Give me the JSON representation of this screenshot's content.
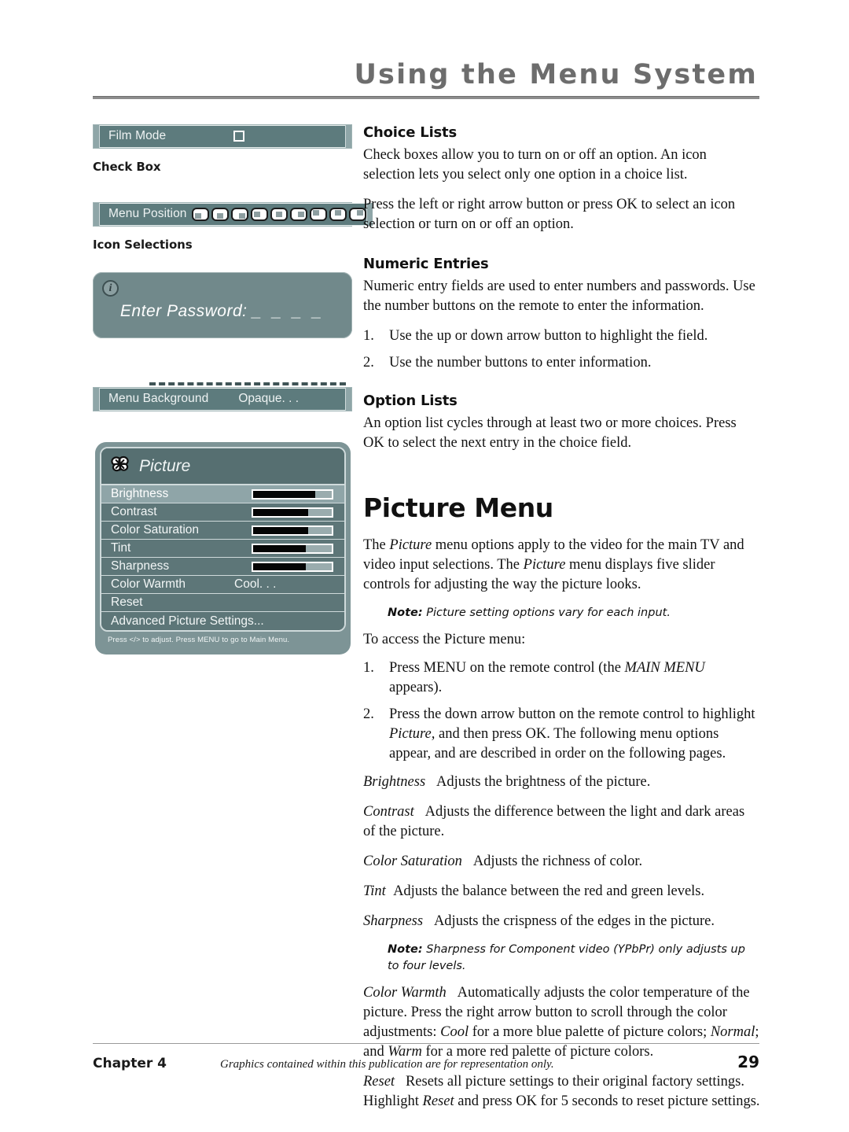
{
  "header": {
    "title": "Using the Menu System"
  },
  "osd": {
    "check_box": {
      "label": "Film Mode",
      "checkbox_state": "unchecked",
      "caption": "Check Box"
    },
    "icon_selections": {
      "label": "Menu Position",
      "caption": "Icon Selections",
      "icons": [
        "position-bottom-left",
        "position-bottom-center",
        "position-bottom-right",
        "position-middle-left",
        "position-middle-center",
        "position-middle-right",
        "position-top-left",
        "position-top-center",
        "position-top-right"
      ]
    },
    "password_box": {
      "info_glyph": "i",
      "prompt": "Enter Password:",
      "blanks": "_ _ _ _"
    },
    "menu_background": {
      "label": "Menu Background",
      "value": "Opaque. . ."
    }
  },
  "picture_menu_panel": {
    "icon": "butterfly-picture-icon",
    "title": "Picture",
    "rows": [
      {
        "label": "Brightness",
        "type": "slider",
        "fill_percent": 79,
        "highlighted": true
      },
      {
        "label": "Contrast",
        "type": "slider",
        "fill_percent": 70,
        "highlighted": false
      },
      {
        "label": "Color Saturation",
        "type": "slider",
        "fill_percent": 70,
        "highlighted": false
      },
      {
        "label": "Tint",
        "type": "slider",
        "fill_percent": 67,
        "highlighted": false
      },
      {
        "label": "Sharpness",
        "type": "slider",
        "fill_percent": 67,
        "highlighted": false
      },
      {
        "label": "Color Warmth",
        "type": "option",
        "value": "Cool. . .",
        "highlighted": false
      },
      {
        "label": "Reset",
        "type": "plain",
        "highlighted": false
      },
      {
        "label": "Advanced Picture Settings...",
        "type": "plain",
        "highlighted": false
      }
    ],
    "footer": "Press </> to adjust. Press MENU to go to Main Menu."
  },
  "content": {
    "choice_lists": {
      "heading": "Choice Lists",
      "p1": "Check boxes allow you to turn on or off an option. An icon selection lets you select only one option in a choice list.",
      "p2": "Press the left or right arrow button or press OK to select an icon selection or turn on or off an option."
    },
    "numeric_entries": {
      "heading": "Numeric Entries",
      "p1": "Numeric entry fields are used to enter numbers and passwords. Use the number buttons on the remote to enter the information.",
      "steps": [
        {
          "num": "1.",
          "text": "Use the up or down arrow button to highlight the field."
        },
        {
          "num": "2.",
          "text": "Use the number buttons to enter information."
        }
      ]
    },
    "option_lists": {
      "heading": "Option Lists",
      "p1": "An option list cycles through at least two or more choices. Press OK to select the next entry in the choice field."
    },
    "picture_menu": {
      "heading": "Picture Menu",
      "intro_a": "The ",
      "intro_b": "Picture",
      "intro_c": " menu options apply to the video for the main TV and video input selections. The ",
      "intro_d": "Picture",
      "intro_e": " menu displays five slider controls for adjusting the way the picture looks.",
      "note1_label": "Note:",
      "note1_text": " Picture setting options vary for each input.",
      "access_line": "To access the Picture menu:",
      "steps": [
        {
          "num": "1.",
          "pre": "Press MENU on the remote control (the ",
          "em": "MAIN MENU",
          "post": " appears)."
        },
        {
          "num": "2.",
          "pre": "Press the down arrow button on the remote control to highlight ",
          "em": "Picture,",
          "post": " and then press OK. The following menu options appear, and are described in order on the following pages."
        }
      ],
      "definitions": [
        {
          "term": "Brightness",
          "text": "Adjusts the brightness of the picture."
        },
        {
          "term": "Contrast",
          "text": "Adjusts the difference between the light and dark areas of the picture."
        },
        {
          "term": "Color Saturation",
          "text": "Adjusts the richness of color."
        },
        {
          "term": "Tint",
          "text": "Adjusts the balance between the red and green levels."
        },
        {
          "term": "Sharpness",
          "text": "Adjusts the crispness of the edges in the picture."
        }
      ],
      "note2_label": "Note:",
      "note2_text": " Sharpness for Component video (YPbPr) only adjusts up to four levels.",
      "color_warmth": {
        "term": "Color Warmth",
        "t1": "Automatically adjusts the color temperature of the picture. Press the right arrow button to scroll through the color adjustments: ",
        "em1": "Cool",
        "t2": " for a more blue palette of picture colors; ",
        "em2": "Normal",
        "t3": "; and ",
        "em3": "Warm",
        "t4": " for a more red palette of picture colors."
      },
      "reset": {
        "term": "Reset",
        "t1": "Resets all picture settings to their original factory settings. Highlight ",
        "em1": "Reset",
        "t2": " and press OK for 5 seconds to reset picture settings."
      }
    }
  },
  "footer": {
    "chapter": "Chapter 4",
    "note": "Graphics contained within this publication are for representation only.",
    "page_number": "29"
  }
}
